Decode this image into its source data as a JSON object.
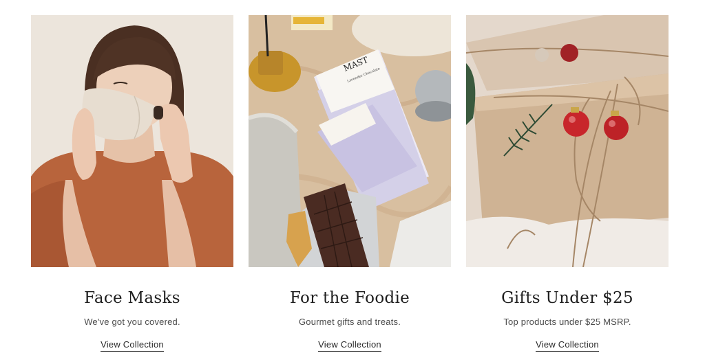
{
  "collections": [
    {
      "title": "Face Masks",
      "subtitle": "We've got you covered.",
      "link_label": "View Collection",
      "image_alt": "Woman putting on a linen face mask"
    },
    {
      "title": "For the Foodie",
      "subtitle": "Gourmet gifts and treats.",
      "link_label": "View Collection",
      "image_alt": "Mast chocolate bars on a marble table"
    },
    {
      "title": "Gifts Under $25",
      "subtitle": "Top products under $25 MSRP.",
      "link_label": "View Collection",
      "image_alt": "Kraft paper wrapped gift with twine and red ornaments"
    }
  ],
  "brand_print": {
    "chocolate_brand": "MAST",
    "chocolate_flavor": "Lavender Chocolate"
  },
  "colors": {
    "title": "#1e1e1e",
    "text": "#4a4a4a",
    "background": "#ffffff"
  }
}
